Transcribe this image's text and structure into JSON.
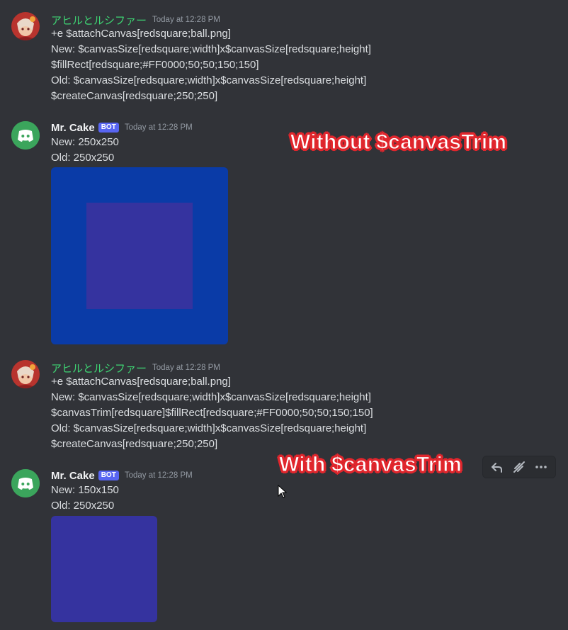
{
  "messages": [
    {
      "username": "アヒルとルシファー",
      "timestamp": "Today at 12:28 PM",
      "lines": [
        "+e $attachCanvas[redsquare;ball.png]",
        "New: $canvasSize[redsquare;width]x$canvasSize[redsquare;height]",
        "$fillRect[redsquare;#FF0000;50;50;150;150]",
        "Old: $canvasSize[redsquare;width]x$canvasSize[redsquare;height]",
        "$createCanvas[redsquare;250;250]"
      ]
    },
    {
      "username": "Mr. Cake",
      "bot_tag": "BOT",
      "timestamp": "Today at 12:28 PM",
      "lines": [
        "New: 250x250",
        "Old: 250x250"
      ]
    },
    {
      "username": "アヒルとルシファー",
      "timestamp": "Today at 12:28 PM",
      "lines": [
        "+e $attachCanvas[redsquare;ball.png]",
        "New: $canvasSize[redsquare;width]x$canvasSize[redsquare;height]",
        "$canvasTrim[redsquare]$fillRect[redsquare;#FF0000;50;50;150;150]",
        "Old: $canvasSize[redsquare;width]x$canvasSize[redsquare;height]",
        "$createCanvas[redsquare;250;250]"
      ]
    },
    {
      "username": "Mr. Cake",
      "bot_tag": "BOT",
      "timestamp": "Today at 12:28 PM",
      "lines": [
        "New: 150x150",
        "Old: 250x250"
      ]
    }
  ],
  "annotations": {
    "without": "Without $canvasTrim",
    "with": "With $canvasTrim"
  },
  "toolbar": {
    "icons": [
      "reply-icon",
      "spring-icon",
      "more-icon"
    ]
  },
  "colors": {
    "background": "#313338",
    "user_name": "#3ed573",
    "bot_tag": "#5865f2",
    "bot_avatar": "#3ba55c",
    "canvas_blue": "#0a3ba7",
    "square_purple": "#35339f",
    "annotation_outline": "#e0262d"
  }
}
